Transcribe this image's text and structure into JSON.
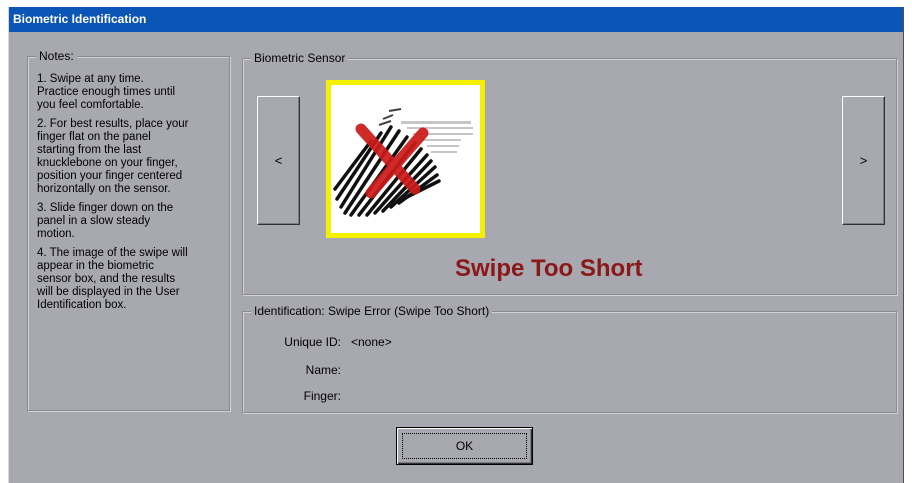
{
  "window": {
    "title": "Biometric Identification"
  },
  "notes": {
    "legend": "Notes:",
    "items": [
      "1. Swipe at any time.\nPractice enough times until\nyou feel comfortable.",
      "2. For best results, place your\nfinger flat on the panel\nstarting from the last\nknucklebone on your finger,\nposition your finger centered\nhorizontally on the sensor.",
      "3. Slide finger down on the\npanel in a slow steady\nmotion.",
      "4. The image of the swipe will\nappear in the biometric\nsensor box, and the results\nwill be displayed in the User\nIdentification box."
    ]
  },
  "sensor": {
    "legend": "Biometric Sensor",
    "prev_label": "<",
    "next_label": ">",
    "image_icon": "fingerprint-swipe-error-icon",
    "status": "Swipe Too Short",
    "status_color": "#8b1818",
    "frame_color": "#f4f000"
  },
  "identification": {
    "legend": "Identification: Swipe Error (Swipe Too Short)",
    "fields": [
      {
        "label": "Unique ID:",
        "value": "<none>"
      },
      {
        "label": "Name:",
        "value": ""
      },
      {
        "label": "Finger:",
        "value": ""
      }
    ]
  },
  "footer": {
    "ok_label": "OK"
  },
  "colors": {
    "title_bar": "#0a55b5",
    "dialog_bg": "#a8a8b0"
  }
}
